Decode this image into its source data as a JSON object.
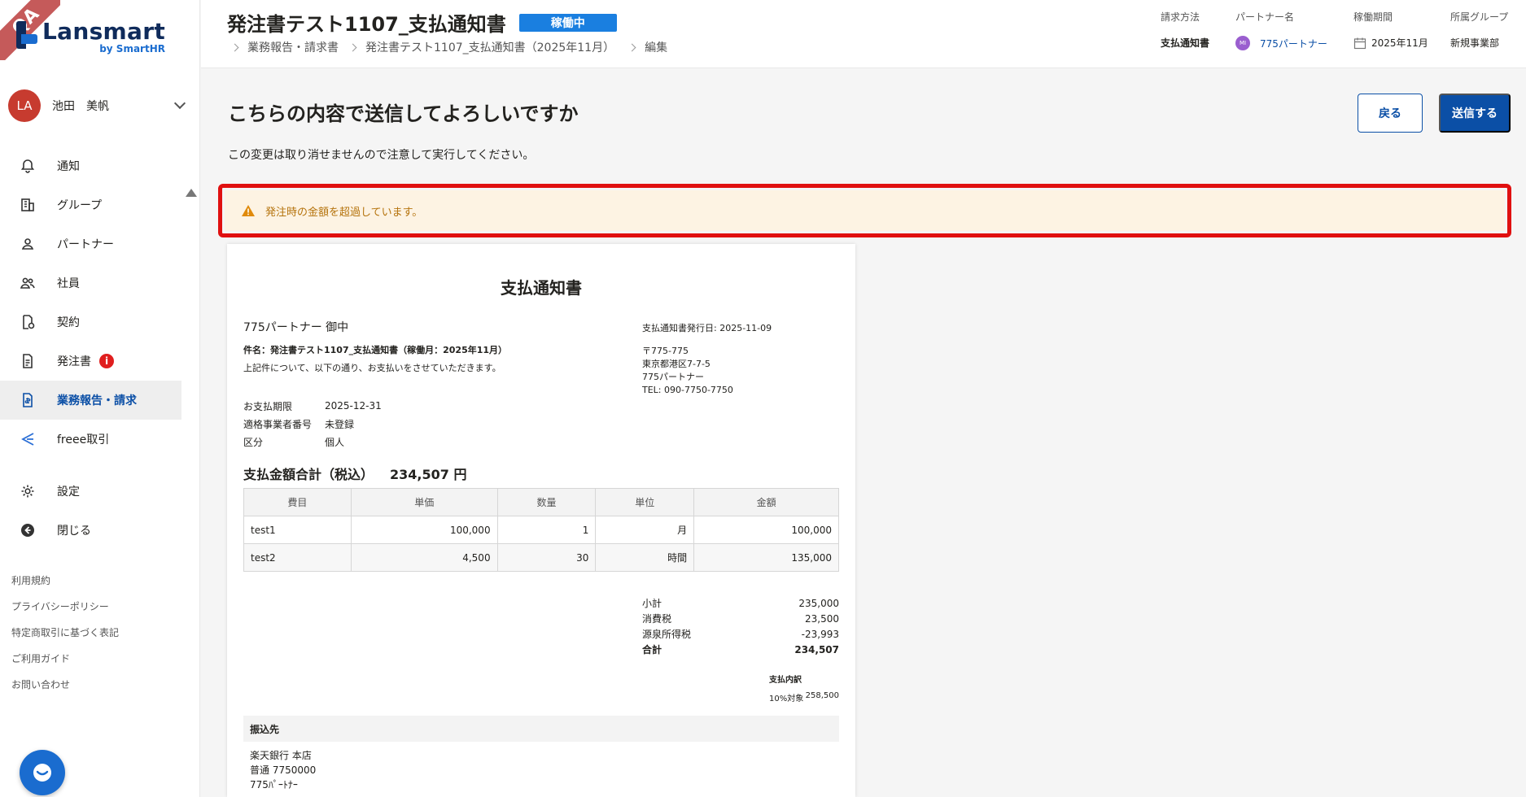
{
  "brand": {
    "ribbon": "QA",
    "name": "Lansmart",
    "by": "by SmartHR"
  },
  "user": {
    "initials": "LA",
    "name": "池田　美帆"
  },
  "nav": [
    {
      "label": "通知",
      "icon": "bell-icon"
    },
    {
      "label": "グループ",
      "icon": "building-icon"
    },
    {
      "label": "パートナー",
      "icon": "person-icon"
    },
    {
      "label": "社員",
      "icon": "people-icon"
    },
    {
      "label": "契約",
      "icon": "contract-icon"
    },
    {
      "label": "発注書",
      "icon": "document-icon",
      "badge": "i"
    },
    {
      "label": "業務報告・請求",
      "icon": "invoice-icon",
      "active": true
    },
    {
      "label": "freee取引",
      "icon": "freee-icon"
    },
    {
      "label": "設定",
      "icon": "gear-icon"
    },
    {
      "label": "閉じる",
      "icon": "collapse-icon"
    }
  ],
  "footer_links": [
    "利用規約",
    "プライバシーポリシー",
    "特定商取引に基づく表記",
    "ご利用ガイド",
    "お問い合わせ"
  ],
  "header": {
    "title": "発注書テスト1107_支払通知書",
    "status": "稼働中",
    "breadcrumb": [
      "業務報告・請求書",
      "発注書テスト1107_支払通知書（2025年11月）",
      "編集"
    ],
    "meta": [
      {
        "label": "請求方法",
        "value": "支払通知書"
      },
      {
        "label": "パートナー名",
        "value": "775パートナー",
        "avatar": "MI"
      },
      {
        "label": "稼働期間",
        "value": "2025年11月"
      },
      {
        "label": "所属グループ",
        "value": "新規事業部"
      }
    ]
  },
  "confirm": {
    "title": "こちらの内容で送信してよろしいですか",
    "subtitle": "この変更は取り消せませんので注意して実行してください。",
    "back_label": "戻る",
    "send_label": "送信する"
  },
  "alert": {
    "message": "発注時の金額を超過しています。"
  },
  "document": {
    "title": "支払通知書",
    "recipient": "775パートナー 御中",
    "subject": "件名：発注書テスト1107_支払通知書（稼働月：2025年11月）",
    "intro": "上記件について、以下の通り、お支払いをさせていただきます。",
    "info": [
      {
        "k": "お支払期限",
        "v": "2025-12-31"
      },
      {
        "k": "適格事業者番号",
        "v": "未登録"
      },
      {
        "k": "区分",
        "v": "個人"
      }
    ],
    "issued": "支払通知書発行日: 2025-11-09",
    "address": [
      "〒775-775",
      "東京都港区7-7-5",
      "775パートナー",
      "TEL: 090-7750-7750"
    ],
    "total_label": "支払金額合計（税込）",
    "total_amount": "234,507 円",
    "columns": [
      "費目",
      "単価",
      "数量",
      "単位",
      "金額"
    ],
    "rows": [
      [
        "test1",
        "100,000",
        "1",
        "月",
        "100,000"
      ],
      [
        "test2",
        "4,500",
        "30",
        "時間",
        "135,000"
      ]
    ],
    "sums": [
      {
        "k": "小計",
        "v": "235,000"
      },
      {
        "k": "消費税",
        "v": "23,500"
      },
      {
        "k": "源泉所得税",
        "v": "-23,993"
      },
      {
        "k": "合計",
        "v": "234,507",
        "bold": true
      }
    ],
    "breakdown_title": "支払内訳",
    "breakdown": {
      "k": "10%対象",
      "v": "258,500"
    },
    "bank_title": "振込先",
    "bank_lines": [
      "楽天銀行 本店",
      "普通 7750000",
      "775ﾊﾟｰﾄﾅｰ"
    ]
  },
  "colors": {
    "primary": "#0b4fa6",
    "status": "#1a7fe0",
    "alert_bg": "#fdf3e3",
    "alert_text": "#b5730c",
    "highlight": "#e01010",
    "avatar": "#c73b2f"
  }
}
